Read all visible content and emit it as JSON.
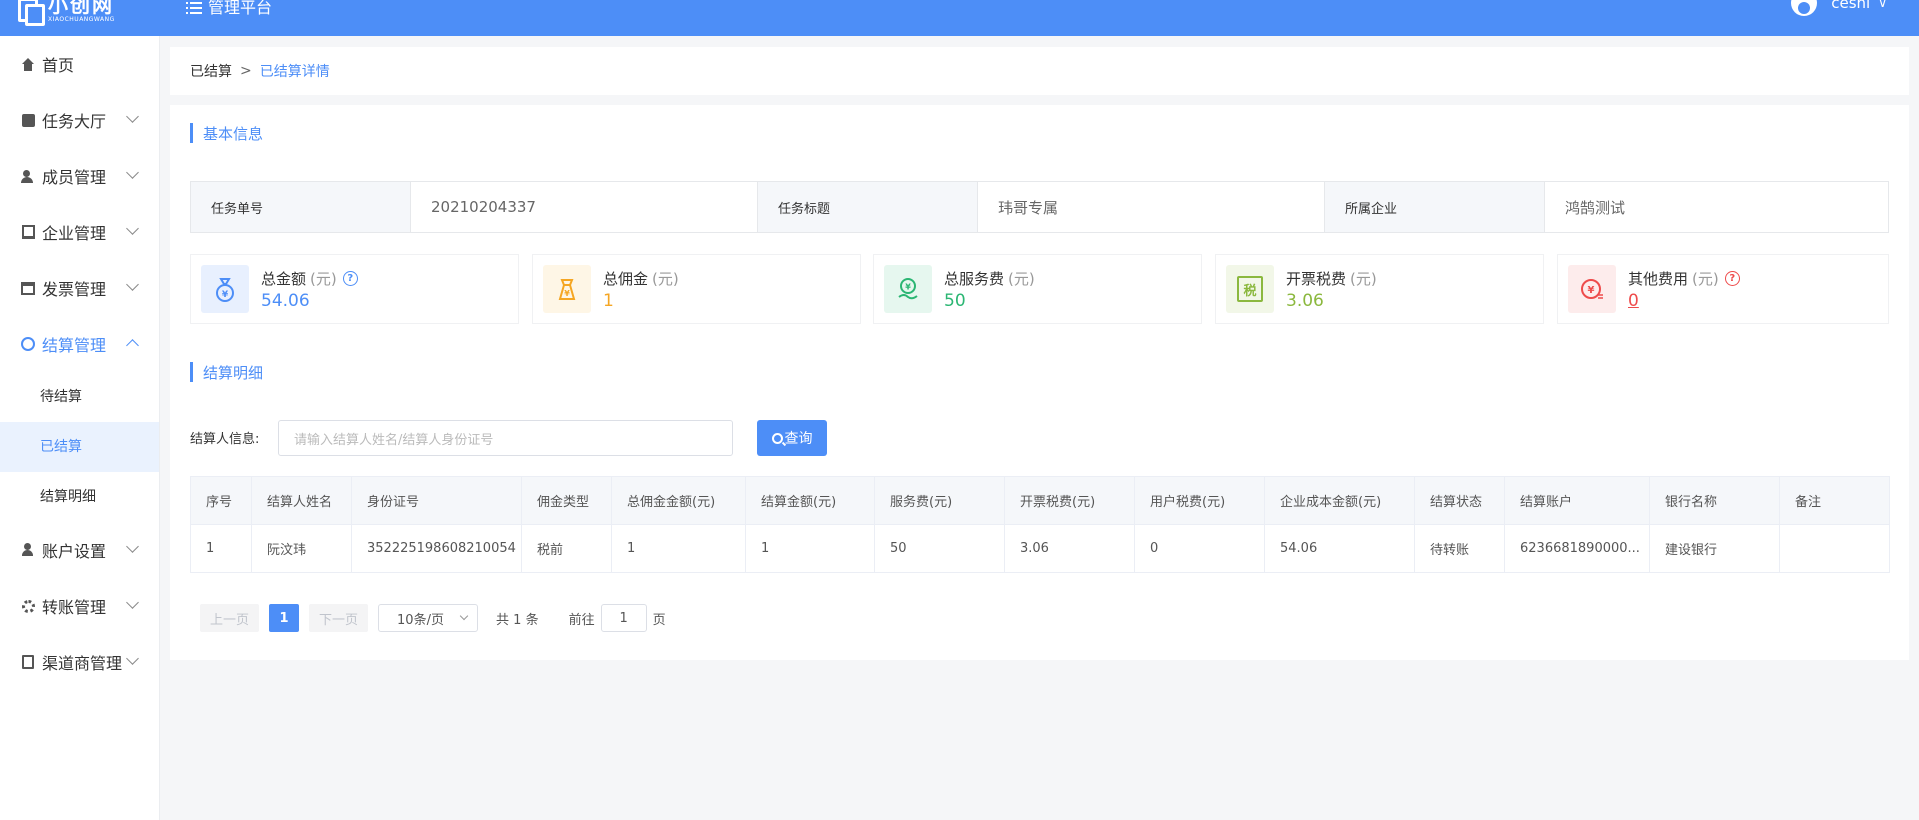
{
  "header": {
    "logo_name": "小创网",
    "logo_sub": "XIAOCHUANGWANG",
    "platform_title": "管理平台",
    "username": "ceshi"
  },
  "sidebar": {
    "items": [
      {
        "label": "首页",
        "icon": "home-icon"
      },
      {
        "label": "任务大厅",
        "icon": "task-icon"
      },
      {
        "label": "成员管理",
        "icon": "users-icon"
      },
      {
        "label": "企业管理",
        "icon": "building-icon"
      },
      {
        "label": "发票管理",
        "icon": "invoice-icon"
      },
      {
        "label": "结算管理",
        "icon": "settlement-icon"
      },
      {
        "label": "账户设置",
        "icon": "account-icon"
      },
      {
        "label": "转账管理",
        "icon": "transfer-icon"
      },
      {
        "label": "渠道商管理",
        "icon": "channel-icon"
      }
    ],
    "sub_items": [
      "待结算",
      "已结算",
      "结算明细"
    ]
  },
  "breadcrumb": {
    "parent": "已结算",
    "separator": ">",
    "current": "已结算详情"
  },
  "basic_info": {
    "title": "基本信息",
    "fields": [
      {
        "key": "任务单号",
        "value": "20210204337"
      },
      {
        "key": "任务标题",
        "value": "玮哥专属"
      },
      {
        "key": "所属企业",
        "value": "鸿鹄测试"
      }
    ]
  },
  "stats": [
    {
      "label": "总金额",
      "unit": "(元)",
      "value": "54.06",
      "color": "#4d8ef7",
      "icon": "money-bag-icon",
      "has_help": true
    },
    {
      "label": "总佣金",
      "unit": "(元)",
      "value": "1",
      "color": "#f5a623",
      "icon": "commission-icon",
      "has_help": false
    },
    {
      "label": "总服务费",
      "unit": "(元)",
      "value": "50",
      "color": "#2bb673",
      "icon": "service-fee-icon",
      "has_help": false
    },
    {
      "label": "开票税费",
      "unit": "(元)",
      "value": "3.06",
      "color": "#8bb83e",
      "icon": "tax-icon",
      "icon_text": "税",
      "has_help": false
    },
    {
      "label": "其他费用",
      "unit": "(元)",
      "value": "0",
      "color": "#ee4b4b",
      "icon": "other-fee-icon",
      "has_help": true
    }
  ],
  "detail": {
    "title": "结算明细",
    "filter_label": "结算人信息:",
    "filter_placeholder": "请输入结算人姓名/结算人身份证号",
    "search_label": "查询",
    "columns": [
      "序号",
      "结算人姓名",
      "身份证号",
      "佣金类型",
      "总佣金金额(元)",
      "结算金额(元)",
      "服务费(元)",
      "开票税费(元)",
      "用户税费(元)",
      "企业成本金额(元)",
      "结算状态",
      "结算账户",
      "银行名称",
      "备注"
    ],
    "rows": [
      [
        "1",
        "阮汶玮",
        "352225198608210054",
        "税前",
        "1",
        "1",
        "50",
        "3.06",
        "0",
        "54.06",
        "待转账",
        "6236681890000...",
        "建设银行",
        ""
      ]
    ]
  },
  "pagination": {
    "prev": "上一页",
    "page": "1",
    "next": "下一页",
    "page_size": "10条/页",
    "total": "共 1 条",
    "goto_prefix": "前往",
    "goto_value": "1",
    "goto_suffix": "页"
  }
}
